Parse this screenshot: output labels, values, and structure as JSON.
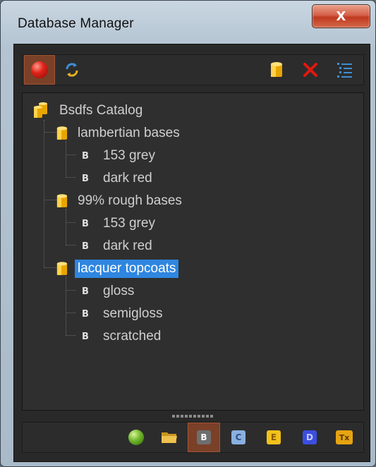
{
  "window": {
    "title": "Database Manager",
    "close_label": "X"
  },
  "toolbar": {
    "icons": [
      "record-icon",
      "refresh-icon",
      "database-icon",
      "delete-icon",
      "list-icon"
    ]
  },
  "tree": {
    "root": {
      "label": "Bsdfs Catalog"
    },
    "groups": [
      {
        "label": "lambertian bases",
        "items": [
          "153 grey",
          "dark red"
        ]
      },
      {
        "label": "99% rough bases",
        "items": [
          "153 grey",
          "dark red"
        ]
      },
      {
        "label": "lacquer topcoats",
        "items": [
          "gloss",
          "semigloss",
          "scratched"
        ],
        "selected": true
      }
    ],
    "item_icon_letter": "B"
  },
  "bottom_toolbar": {
    "b_label": "B",
    "c_label": "C",
    "e_label": "E",
    "d_label": "D",
    "tx_label": "Tx"
  },
  "colors": {
    "selection": "#2f86e0",
    "panel_bg": "#2f2f2f",
    "active_button": "#7a4028"
  }
}
